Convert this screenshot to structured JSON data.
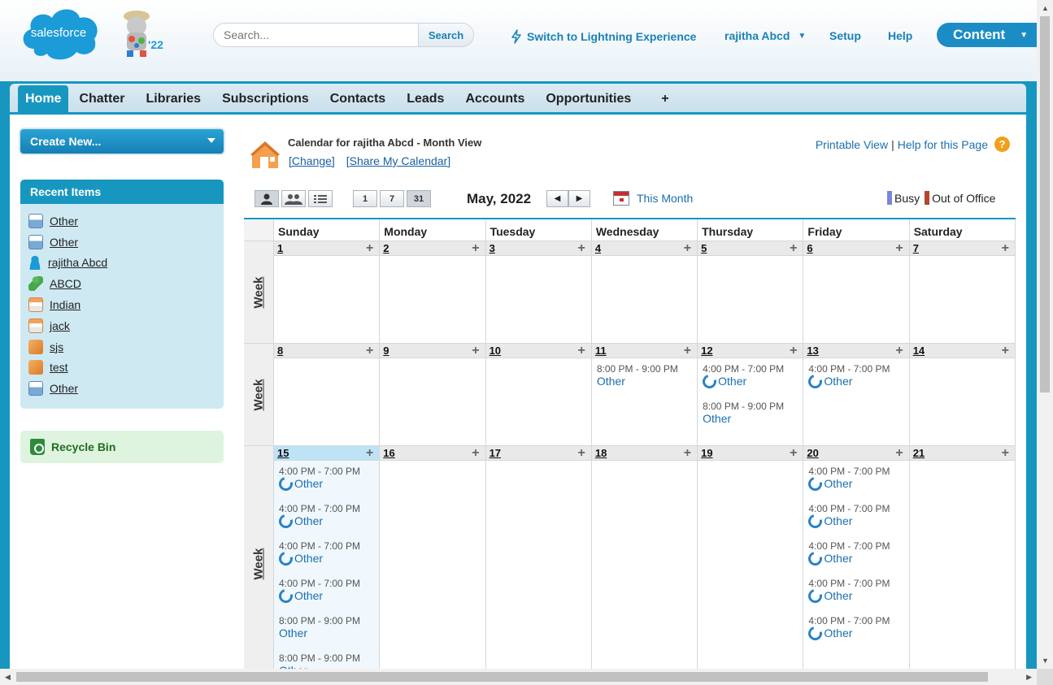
{
  "header": {
    "logo_text": "salesforce",
    "mascot_badge": "'22",
    "search_placeholder": "Search...",
    "search_button": "Search",
    "lightning_link": "Switch to Lightning Experience",
    "user_name": "rajitha Abcd",
    "setup": "Setup",
    "help": "Help",
    "app_menu": "Content"
  },
  "tabs": [
    "Home",
    "Chatter",
    "Libraries",
    "Subscriptions",
    "Contacts",
    "Leads",
    "Accounts",
    "Opportunities",
    "+"
  ],
  "sidebar": {
    "create_new": "Create New...",
    "recent_title": "Recent Items",
    "recent_items": [
      {
        "label": "Other",
        "icon": "event-icon"
      },
      {
        "label": "Other",
        "icon": "event-icon"
      },
      {
        "label": "rajitha Abcd",
        "icon": "user-icon"
      },
      {
        "label": "ABCD",
        "icon": "contact-icon"
      },
      {
        "label": "Indian",
        "icon": "case-icon"
      },
      {
        "label": "jack",
        "icon": "case-icon"
      },
      {
        "label": "sjs",
        "icon": "box-icon"
      },
      {
        "label": "test",
        "icon": "box-icon"
      },
      {
        "label": "Other",
        "icon": "event-icon"
      }
    ],
    "recycle_bin": "Recycle Bin"
  },
  "calendar": {
    "title": "Calendar for rajitha Abcd - Month View",
    "change_link": "[Change]",
    "share_link": "[Share My Calendar]",
    "printable_view": "Printable View",
    "separator": "|",
    "help_page": "Help for this Page",
    "help_icon": "?",
    "range_buttons": [
      "1",
      "7",
      "31"
    ],
    "month_label": "May, 2022",
    "this_month": "This Month",
    "legend": {
      "busy": "Busy",
      "out_of_office": "Out of Office",
      "busy_color": "#7a86d8",
      "ooo_color": "#b5462f"
    },
    "week_label": "Week",
    "day_names": [
      "Sunday",
      "Monday",
      "Tuesday",
      "Wednesday",
      "Thursday",
      "Friday",
      "Saturday"
    ],
    "weeks": [
      {
        "days": [
          {
            "num": "1",
            "events": []
          },
          {
            "num": "2",
            "events": []
          },
          {
            "num": "3",
            "events": []
          },
          {
            "num": "4",
            "events": []
          },
          {
            "num": "5",
            "events": []
          },
          {
            "num": "6",
            "events": []
          },
          {
            "num": "7",
            "events": []
          }
        ]
      },
      {
        "days": [
          {
            "num": "8",
            "events": []
          },
          {
            "num": "9",
            "events": []
          },
          {
            "num": "10",
            "events": []
          },
          {
            "num": "11",
            "events": [
              {
                "time": "8:00 PM - 9:00 PM",
                "subject": "Other",
                "recurring": false
              }
            ]
          },
          {
            "num": "12",
            "events": [
              {
                "time": "4:00 PM - 7:00 PM",
                "subject": "Other",
                "recurring": true
              },
              {
                "time": "8:00 PM - 9:00 PM",
                "subject": "Other",
                "recurring": false
              }
            ]
          },
          {
            "num": "13",
            "events": [
              {
                "time": "4:00 PM - 7:00 PM",
                "subject": "Other",
                "recurring": true
              }
            ]
          },
          {
            "num": "14",
            "events": []
          }
        ]
      },
      {
        "days": [
          {
            "num": "15",
            "today": true,
            "events": [
              {
                "time": "4:00 PM - 7:00 PM",
                "subject": "Other",
                "recurring": true
              },
              {
                "time": "4:00 PM - 7:00 PM",
                "subject": "Other",
                "recurring": true
              },
              {
                "time": "4:00 PM - 7:00 PM",
                "subject": "Other",
                "recurring": true
              },
              {
                "time": "4:00 PM - 7:00 PM",
                "subject": "Other",
                "recurring": true
              },
              {
                "time": "8:00 PM - 9:00 PM",
                "subject": "Other",
                "recurring": false
              },
              {
                "time": "8:00 PM - 9:00 PM",
                "subject": "Other",
                "recurring": false
              }
            ]
          },
          {
            "num": "16",
            "events": []
          },
          {
            "num": "17",
            "events": []
          },
          {
            "num": "18",
            "events": []
          },
          {
            "num": "19",
            "events": []
          },
          {
            "num": "20",
            "events": [
              {
                "time": "4:00 PM - 7:00 PM",
                "subject": "Other",
                "recurring": true
              },
              {
                "time": "4:00 PM - 7:00 PM",
                "subject": "Other",
                "recurring": true
              },
              {
                "time": "4:00 PM - 7:00 PM",
                "subject": "Other",
                "recurring": true
              },
              {
                "time": "4:00 PM - 7:00 PM",
                "subject": "Other",
                "recurring": true
              },
              {
                "time": "4:00 PM - 7:00 PM",
                "subject": "Other",
                "recurring": true
              }
            ]
          },
          {
            "num": "21",
            "events": []
          }
        ]
      }
    ]
  },
  "colors": {
    "brand": "#1797c0",
    "link": "#1a6fb0",
    "today": "#bfe3f6"
  }
}
